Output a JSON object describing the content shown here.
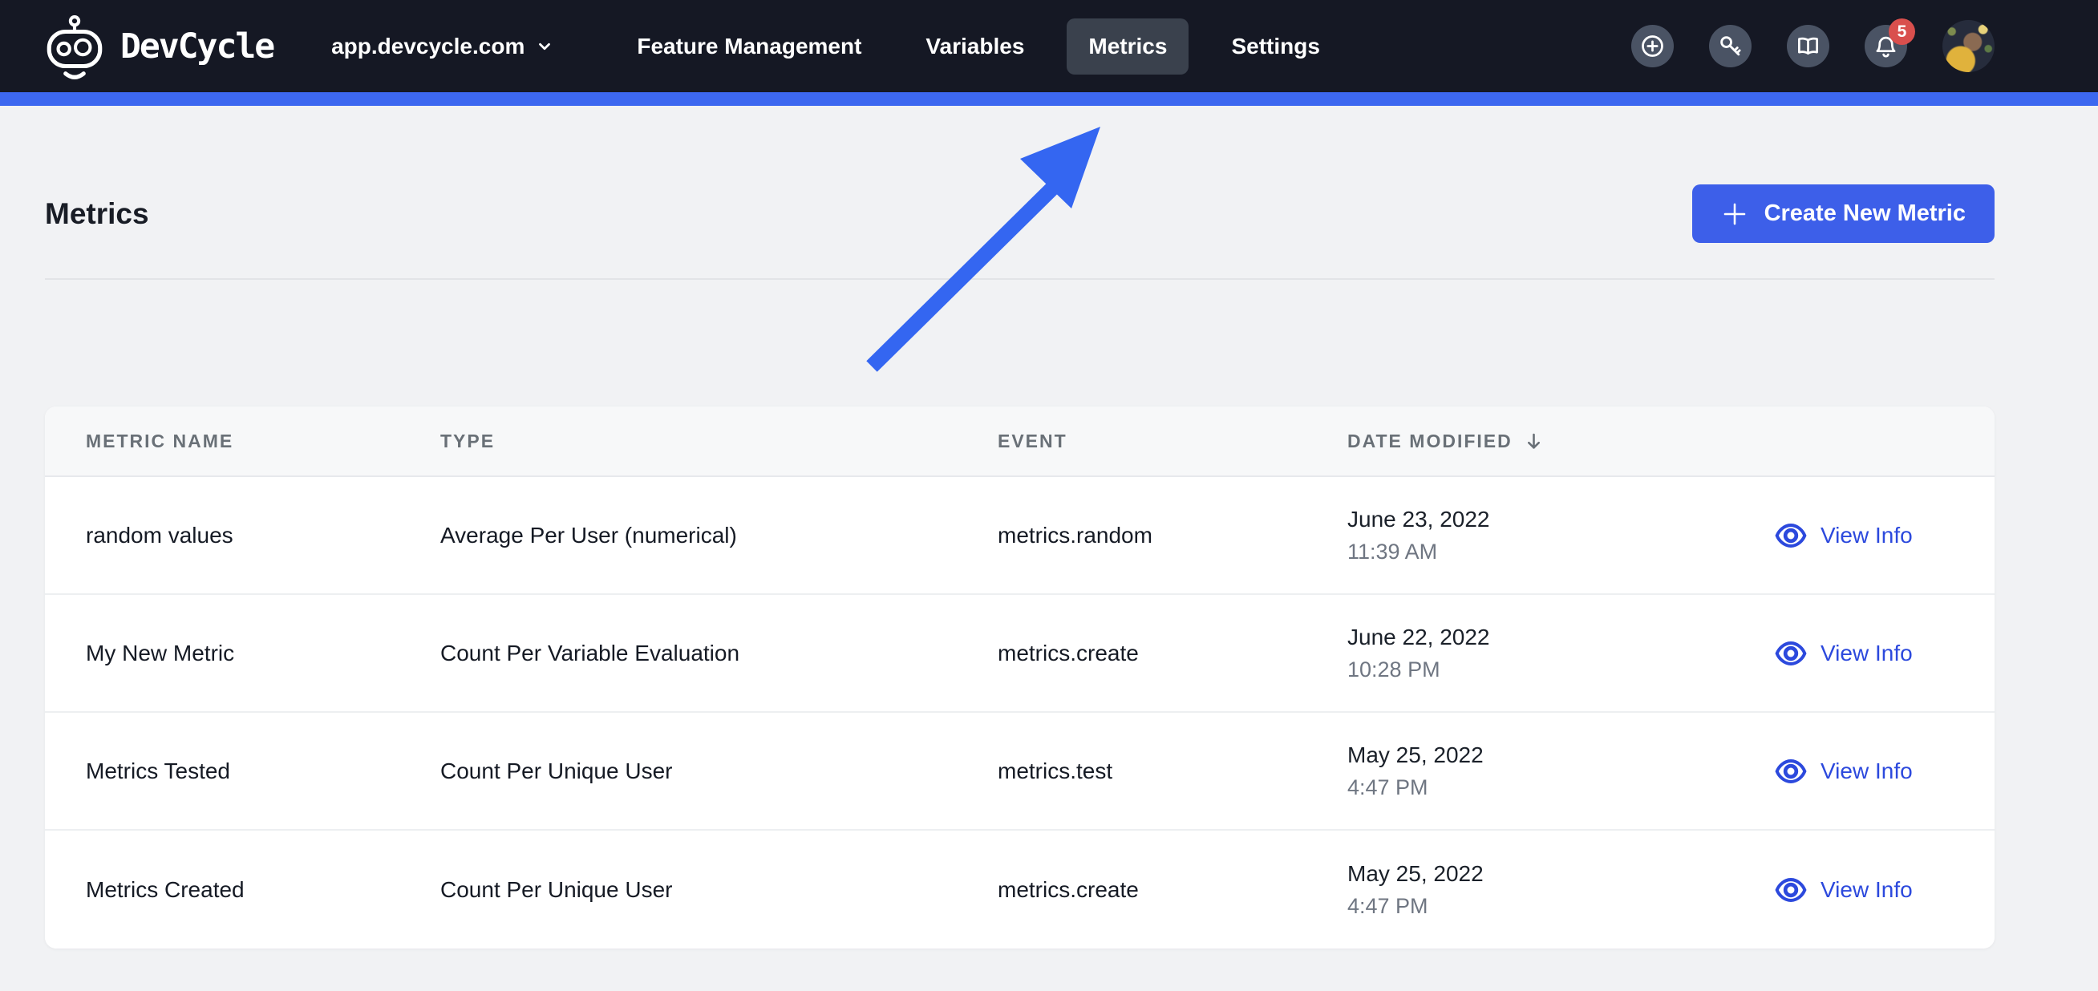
{
  "navbar": {
    "brand": "DevCycle",
    "logo_icon": "robot-icon",
    "org_selector": {
      "label": "app.devcycle.com",
      "icon": "chevron-down-icon"
    },
    "items": [
      {
        "label": "Feature Management",
        "active": false
      },
      {
        "label": "Variables",
        "active": false
      },
      {
        "label": "Metrics",
        "active": true
      },
      {
        "label": "Settings",
        "active": false
      }
    ],
    "actions": {
      "icons": [
        "plus-circle-icon",
        "key-icon",
        "book-open-icon",
        "bell-icon"
      ],
      "notification_count": "5"
    }
  },
  "page": {
    "title": "Metrics",
    "create_button": {
      "label": "Create New Metric",
      "icon": "plus-icon"
    }
  },
  "table": {
    "columns": [
      {
        "label": "METRIC NAME"
      },
      {
        "label": "TYPE"
      },
      {
        "label": "EVENT"
      },
      {
        "label": "DATE MODIFIED",
        "sort": "descending",
        "sort_icon": "arrow-down-icon"
      }
    ],
    "action_label": "View Info",
    "action_icon": "eye-icon",
    "rows": [
      {
        "name": "random values",
        "type": "Average Per User (numerical)",
        "event": "metrics.random",
        "date": "June 23, 2022",
        "time": "11:39 AM"
      },
      {
        "name": "My New Metric",
        "type": "Count Per Variable Evaluation",
        "event": "metrics.create",
        "date": "June 22, 2022",
        "time": "10:28 PM"
      },
      {
        "name": "Metrics Tested",
        "type": "Count Per Unique User",
        "event": "metrics.test",
        "date": "May 25, 2022",
        "time": "4:47 PM"
      },
      {
        "name": "Metrics Created",
        "type": "Count Per Unique User",
        "event": "metrics.create",
        "date": "May 25, 2022",
        "time": "4:47 PM"
      }
    ]
  },
  "annotation": {
    "type": "arrow",
    "points_to": "Metrics nav tab"
  },
  "colors": {
    "navbar_bg": "#151824",
    "active_tab_bg": "#3A414D",
    "accent_bar": "#3D68F0",
    "page_bg": "#F1F2F4",
    "button_blue": "#3D5FE9",
    "link_blue": "#2C49DD",
    "arrow_blue": "#3466F1",
    "badge_red": "#D94F4D"
  }
}
